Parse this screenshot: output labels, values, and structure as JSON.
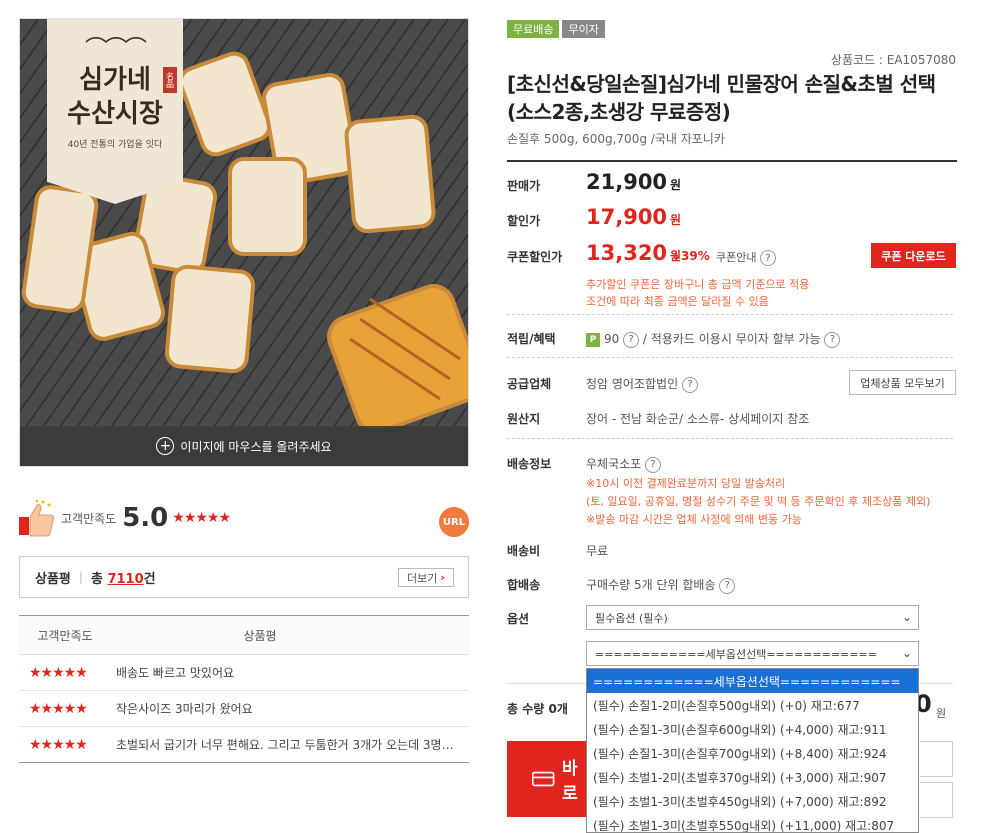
{
  "colors": {
    "accent": "#e0251e",
    "green": "#7cb342",
    "orange": "#f0663a",
    "select_blue": "#1a6fd4"
  },
  "image": {
    "brand_line1": "심가네",
    "brand_line2": "수산시장",
    "brand_tagline": "40년 전통의 가업을 잇다",
    "seal": "名品",
    "hover_text": "이미지에 마우스를 올려주세요"
  },
  "satisfaction": {
    "label": "고객만족도",
    "score": "5.0",
    "stars": "★★★★★",
    "url_badge": "URL"
  },
  "review_summary": {
    "title": "상품평",
    "total_prefix": "총",
    "count": "7110",
    "total_suffix": "건",
    "more_label": "더보기"
  },
  "review_table": {
    "headers": [
      "고객만족도",
      "상품평"
    ],
    "rows": [
      {
        "stars": "★★★★★",
        "text": "배송도 빠르고 맛있어요"
      },
      {
        "stars": "★★★★★",
        "text": "작은사이즈 3마리가 왔어요"
      },
      {
        "stars": "★★★★★",
        "text": "초벌되서 굽기가 너무 편해요. 그리고 두툼한거 3개가 오는데 3명이 ..."
      }
    ]
  },
  "badges": [
    "무료배송",
    "무이자"
  ],
  "product": {
    "code": "상품코드 : EA1057080",
    "title": "[초신선&당일손질]심가네 민물장어 손질&초벌 선택(소스2종,초생강 무료증정)",
    "subtitle": "손질후 500g, 600g,700g /국내 자포니카"
  },
  "prices": {
    "sale_label": "판매가",
    "sale": "21,900",
    "sale_unit": "원",
    "disc_label": "할인가",
    "disc": "17,900",
    "disc_unit": "원",
    "coupon_label": "쿠폰할인가",
    "coupon": "13,320",
    "coupon_unit": "원",
    "discount_pct": "↓39%",
    "coupon_info": "쿠폰안내",
    "coupon_button": "쿠폰 다운로드",
    "note1": "추가할인 쿠폰은 장바구니 총 금액 기준으로 적용",
    "note2": "조건에 따라 최종 금액은 달라질 수 있음"
  },
  "benefit": {
    "label": "적립/혜택",
    "point_icon": "P",
    "points": "90",
    "card_text": "적용카드 이용시 무이자 할부 가능"
  },
  "supplier": {
    "label": "공급업체",
    "value": "청암 영어조합법인",
    "button": "업체상품 모두보기"
  },
  "origin": {
    "label": "원산지",
    "value": "장어 - 전남 화순군/ 소스류- 상세페이지 참조"
  },
  "shipping": {
    "label": "배송정보",
    "value": "우체국소포",
    "note1": "※10시 이전 결제완료분까지 당일 발송처리",
    "note2": "(토, 일요일, 공휴일, 명절 성수기 주문 및 떡 등 주문확인 후 제조상품 제외)",
    "note3": "※발송 마감 시간은 업체 사정에 의해 변동 가능"
  },
  "shipping_fee": {
    "label": "배송비",
    "value": "무료"
  },
  "combined": {
    "label": "합배송",
    "value": "구매수량 5개 단위 합배송"
  },
  "options": {
    "label": "옵션",
    "select1": "필수옵션 (필수)",
    "select2": "============세부옵션선택============",
    "list": [
      "============세부옵션선택============",
      "(필수) 손질1-2미(손질후500g내외) (+0) 재고:677",
      "(필수) 손질1-3미(손질후600g내외) (+4,000) 재고:911",
      "(필수) 손질1-3미(손질후700g내외) (+8,400) 재고:924",
      "(필수) 초벌1-2미(초벌후370g내외) (+3,000) 재고:907",
      "(필수) 초벌1-3미(초벌후450g내외) (+7,000) 재고:892",
      "(필수) 초벌1-3미(초벌후550g내외) (+11,000) 재고:807"
    ],
    "selected_index": 0
  },
  "total": {
    "label": "총 수량 0개",
    "amount": "0",
    "unit": "원"
  },
  "buy": {
    "label": "바로"
  }
}
